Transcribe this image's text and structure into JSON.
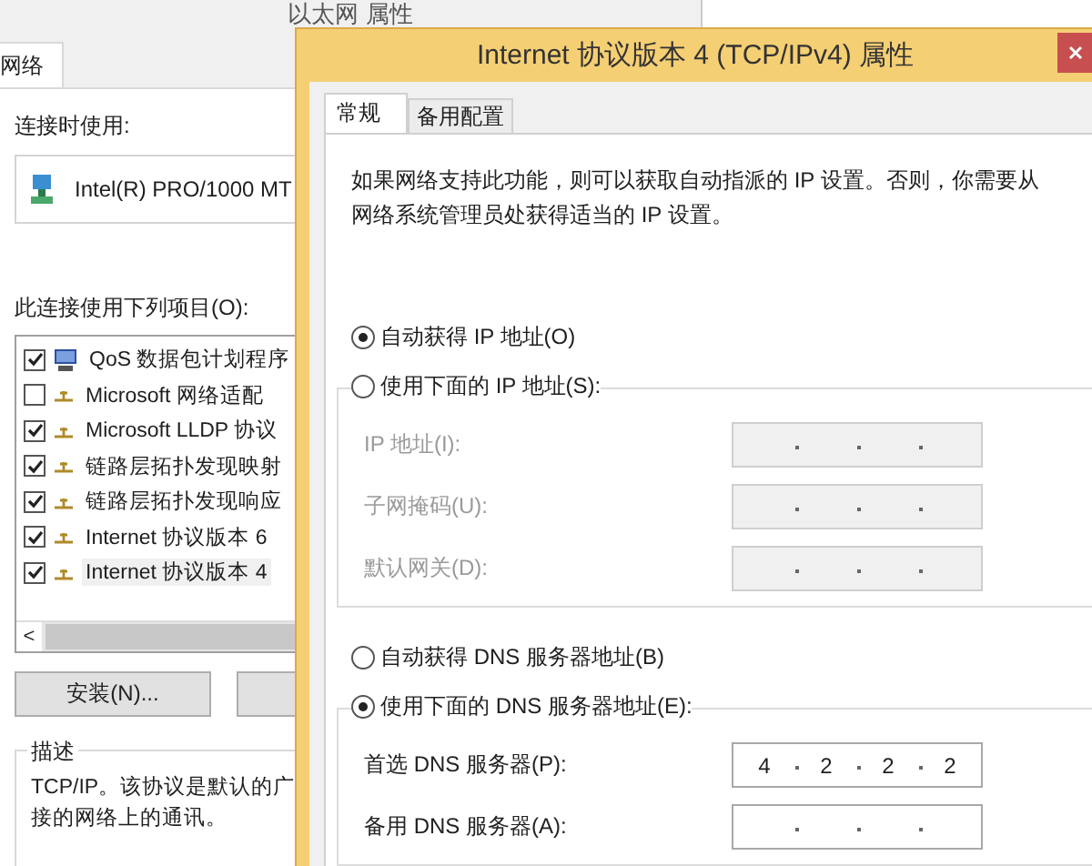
{
  "back_window": {
    "title": "以太网 属性",
    "tabs": [
      {
        "label": "网络",
        "selected": true
      }
    ],
    "connect_using_label": "连接时使用:",
    "adapter": "Intel(R) PRO/1000 MT",
    "items_label": "此连接使用下列项目(O):",
    "items": [
      {
        "label": "QoS 数据包计划程序",
        "checked": true,
        "selected": false,
        "kind": "service"
      },
      {
        "label": "Microsoft 网络适配",
        "checked": false,
        "selected": false,
        "kind": "protocol"
      },
      {
        "label": "Microsoft LLDP 协议",
        "checked": true,
        "selected": false,
        "kind": "protocol"
      },
      {
        "label": "链路层拓扑发现映射",
        "checked": true,
        "selected": false,
        "kind": "protocol"
      },
      {
        "label": "链路层拓扑发现响应",
        "checked": true,
        "selected": false,
        "kind": "protocol"
      },
      {
        "label": "Internet 协议版本 6",
        "checked": true,
        "selected": false,
        "kind": "protocol"
      },
      {
        "label": "Internet 协议版本 4",
        "checked": true,
        "selected": true,
        "kind": "protocol"
      }
    ],
    "scroll_left": "<",
    "install_button": "安装(N)...",
    "description": {
      "title": "描述",
      "lines": [
        "TCP/IP。该协议是默认的广",
        "接的网络上的通讯。"
      ]
    }
  },
  "dialog": {
    "title": "Internet 协议版本 4 (TCP/IPv4) 属性",
    "tabs": [
      {
        "label": "常规",
        "selected": true
      },
      {
        "label": "备用配置",
        "selected": false
      }
    ],
    "intro": "如果网络支持此功能，则可以获取自动指派的 IP 设置。否则，你需要从网络系统管理员处获得适当的 IP 设置。",
    "ip_mode": [
      {
        "label": "自动获得 IP 地址(O)",
        "selected": true
      },
      {
        "label": "使用下面的 IP 地址(S):",
        "selected": false
      }
    ],
    "ip_fields": [
      {
        "label": "IP 地址(I):",
        "disabled": true
      },
      {
        "label": "子网掩码(U):",
        "disabled": true
      },
      {
        "label": "默认网关(D):",
        "disabled": true
      }
    ],
    "dns_mode": [
      {
        "label": "自动获得 DNS 服务器地址(B)",
        "selected": false
      },
      {
        "label": "使用下面的 DNS 服务器地址(E):",
        "selected": true
      }
    ],
    "dns_fields": [
      {
        "label": "首选 DNS 服务器(P):",
        "disabled": false,
        "octets": [
          "4",
          "2",
          "2",
          "2"
        ]
      },
      {
        "label": "备用 DNS 服务器(A):",
        "disabled": false
      }
    ]
  }
}
